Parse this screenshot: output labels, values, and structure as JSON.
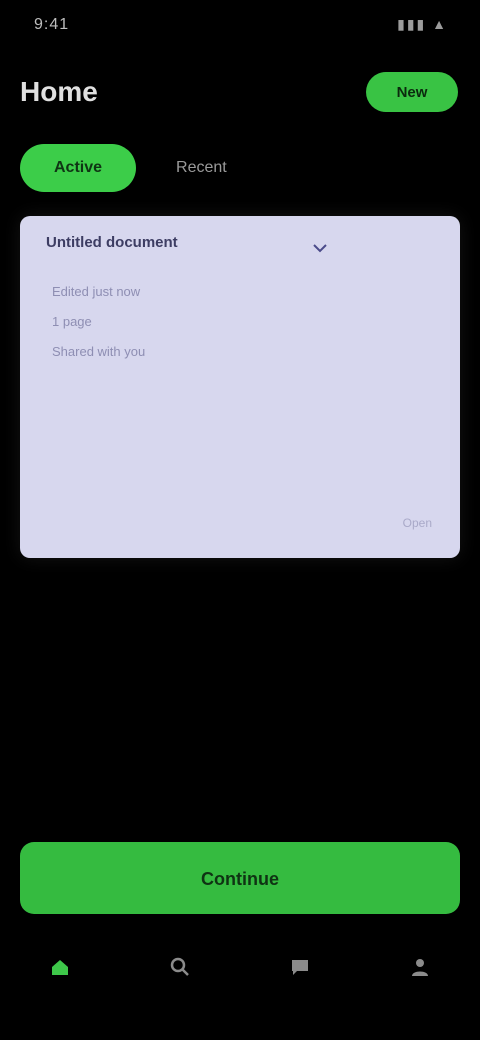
{
  "status_bar": {
    "time": "9:41",
    "icons": "▮▮▮ ▲"
  },
  "header": {
    "title": "Home",
    "action_label": "New"
  },
  "tabs": [
    {
      "label": "Active",
      "active": true
    },
    {
      "label": "Recent",
      "active": false
    }
  ],
  "card": {
    "title": "Untitled document",
    "menu_icon": "chevron-down-icon",
    "lines": [
      "Edited just now",
      "1 page",
      "Shared with you"
    ],
    "footer": "Open"
  },
  "primary_button": {
    "label": "Continue"
  },
  "bottom_nav": {
    "items": [
      {
        "icon": "home-icon",
        "active": true
      },
      {
        "icon": "search-icon",
        "active": false
      },
      {
        "icon": "message-icon",
        "active": false
      },
      {
        "icon": "profile-icon",
        "active": false
      }
    ]
  },
  "colors": {
    "accent": "#3ccd49",
    "background": "#000000",
    "card_bg": "#d7d7ee"
  }
}
